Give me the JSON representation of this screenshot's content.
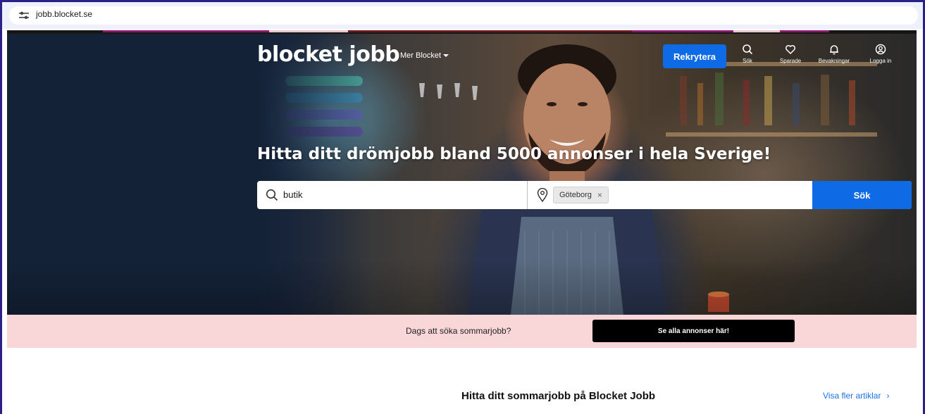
{
  "browser": {
    "url": "jobb.blocket.se"
  },
  "header": {
    "logo": "blocket jobb",
    "more_menu": "Mer Blocket",
    "recruit_button": "Rekrytera",
    "nav": [
      {
        "icon": "search-icon",
        "label": "Sök"
      },
      {
        "icon": "heart-icon",
        "label": "Sparade"
      },
      {
        "icon": "bell-icon",
        "label": "Bevakningar"
      },
      {
        "icon": "user-icon",
        "label": "Logga in"
      }
    ]
  },
  "hero": {
    "headline": "Hitta ditt drömjobb bland 5000 annonser i hela Sverige!",
    "search": {
      "query_value": "butik",
      "location_chip": "Göteborg",
      "chip_remove": "×",
      "submit_label": "Sök"
    }
  },
  "banner": {
    "question": "Dags att söka sommarjobb?",
    "cta": "Se alla annonser här!"
  },
  "content": {
    "section_title": "Hitta ditt sommarjobb på Blocket Jobb",
    "more_link": "Visa fler artiklar",
    "more_link_chevron": "›"
  },
  "colors": {
    "brand_blue": "#0f6ae6",
    "hero_bg": "#142238",
    "banner_bg": "#f9d6d8",
    "cta_bg": "#000000",
    "link": "#1a73e8"
  }
}
